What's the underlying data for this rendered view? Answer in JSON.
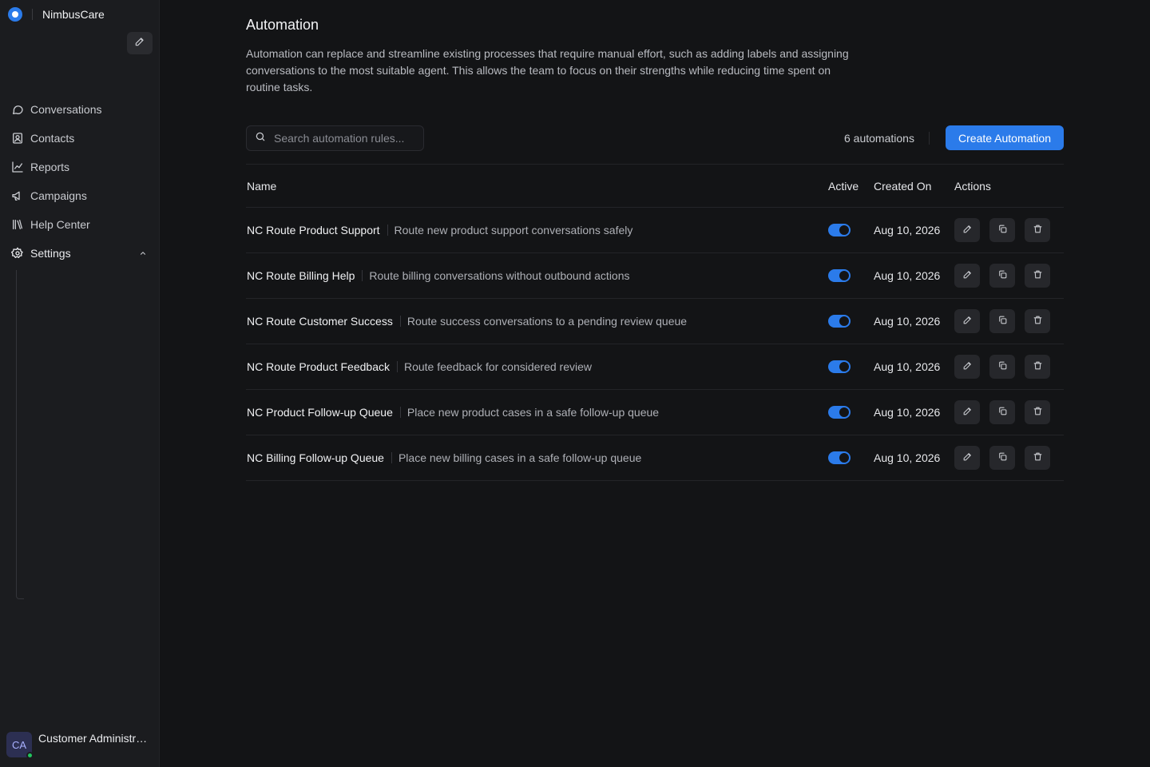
{
  "app": {
    "brand_name": "NimbusCare"
  },
  "sidebar": {
    "items": [
      {
        "label": "Conversations",
        "icon": "chat-bubble-icon"
      },
      {
        "label": "Contacts",
        "icon": "contact-card-icon"
      },
      {
        "label": "Reports",
        "icon": "line-chart-icon"
      },
      {
        "label": "Campaigns",
        "icon": "megaphone-icon"
      },
      {
        "label": "Help Center",
        "icon": "library-books-icon"
      },
      {
        "label": "Settings",
        "icon": "gear-icon",
        "expanded": true
      }
    ],
    "user": {
      "initials": "CA",
      "name": "Customer Administrator",
      "status": "online"
    }
  },
  "main": {
    "title": "Automation",
    "description": "Automation can replace and streamline existing processes that require manual effort, such as adding labels and assigning conversations to the most suitable agent. This allows the team to focus on their strengths while reducing time spent on routine tasks.",
    "search_placeholder": "Search automation rules...",
    "count_label": "6 automations",
    "create_label": "Create Automation",
    "table": {
      "headers": {
        "name": "Name",
        "active": "Active",
        "created": "Created On",
        "actions": "Actions"
      },
      "rows": [
        {
          "name": "NC Route Product Support",
          "description": "Route new product support conversations safely",
          "active": true,
          "created": "Aug 10, 2026"
        },
        {
          "name": "NC Route Billing Help",
          "description": "Route billing conversations without outbound actions",
          "active": true,
          "created": "Aug 10, 2026"
        },
        {
          "name": "NC Route Customer Success",
          "description": "Route success conversations to a pending review queue",
          "active": true,
          "created": "Aug 10, 2026"
        },
        {
          "name": "NC Route Product Feedback",
          "description": "Route feedback for considered review",
          "active": true,
          "created": "Aug 10, 2026"
        },
        {
          "name": "NC Product Follow-up Queue",
          "description": "Place new product cases in a safe follow-up queue",
          "active": true,
          "created": "Aug 10, 2026"
        },
        {
          "name": "NC Billing Follow-up Queue",
          "description": "Place new billing cases in a safe follow-up queue",
          "active": true,
          "created": "Aug 10, 2026"
        }
      ]
    }
  },
  "colors": {
    "accent": "#2b7bea",
    "background": "#131416",
    "sidebar": "#1b1c1f",
    "status_online": "#22c55e"
  }
}
